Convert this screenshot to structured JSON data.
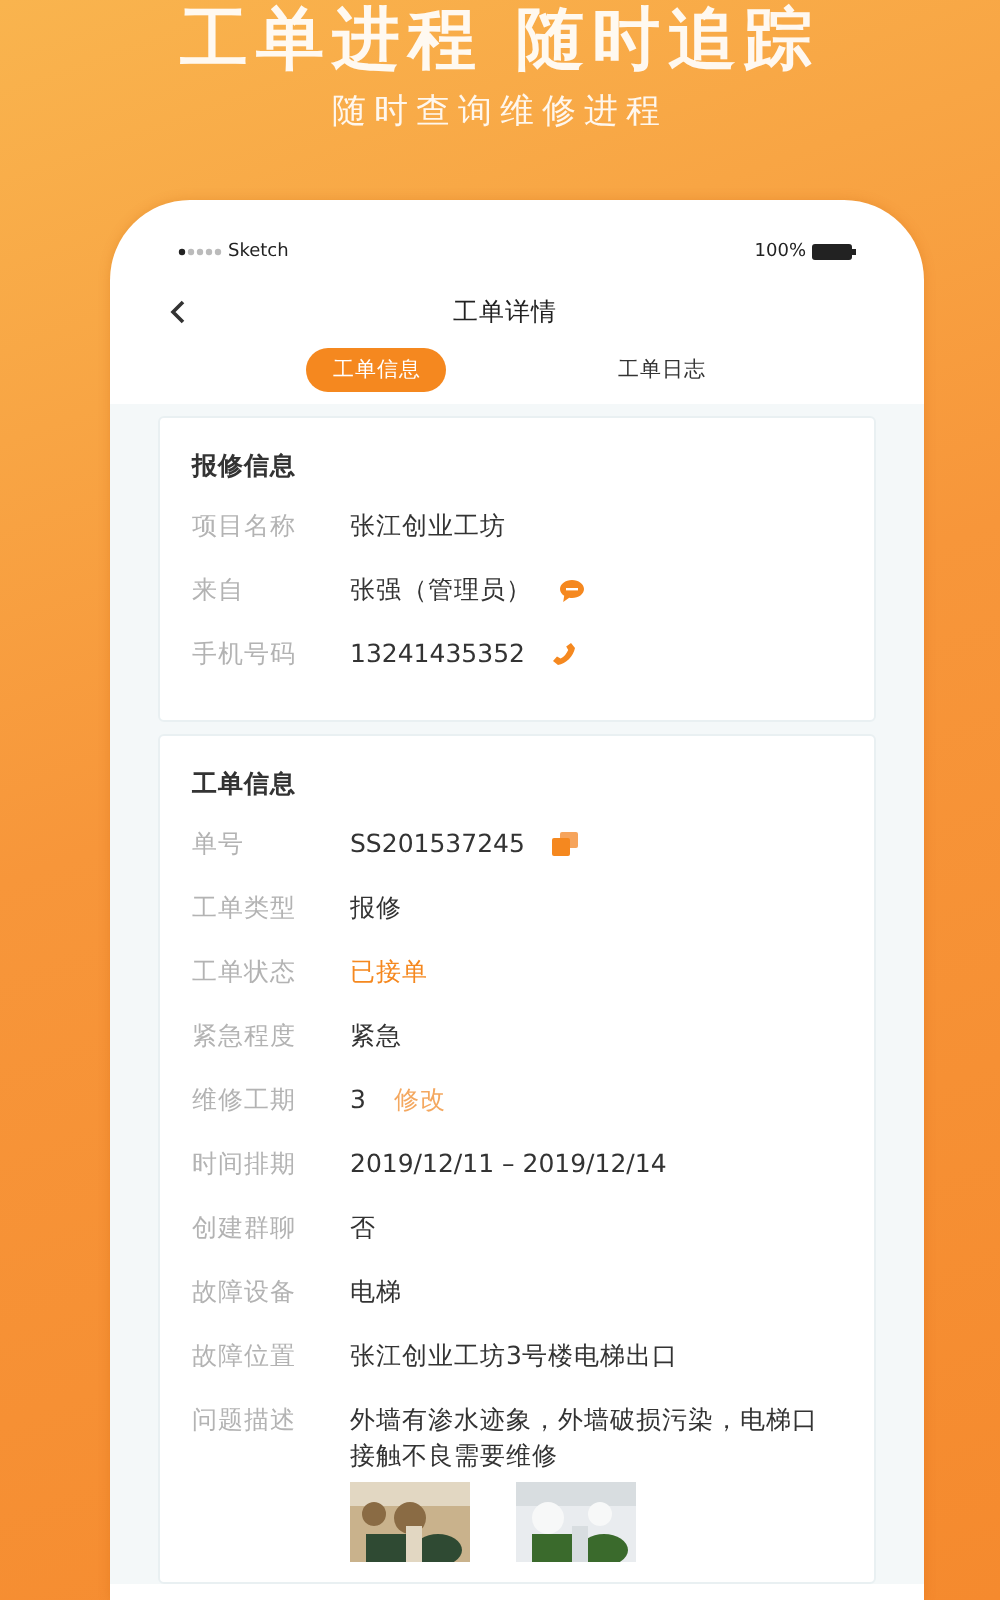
{
  "banner": {
    "title": "工单进程 随时追踪",
    "subtitle": "随时查询维修进程"
  },
  "status_bar": {
    "carrier": "Sketch",
    "battery": "100%"
  },
  "nav": {
    "title": "工单详情"
  },
  "tabs": [
    {
      "label": "工单信息",
      "selected": true
    },
    {
      "label": "工单日志",
      "selected": false
    }
  ],
  "sections": [
    {
      "title": "报修信息",
      "fields": [
        {
          "label": "项目名称",
          "value": "张江创业工坊",
          "kind": "plain"
        },
        {
          "label": "来自",
          "value": "张强（管理员）",
          "kind": "chat"
        },
        {
          "label": "手机号码",
          "value": "13241435352",
          "kind": "phone"
        }
      ]
    },
    {
      "title": "工单信息",
      "fields": [
        {
          "label": "单号",
          "value": "SS201537245",
          "kind": "copy"
        },
        {
          "label": "工单类型",
          "value": "报修",
          "kind": "plain"
        },
        {
          "label": "工单状态",
          "value": "已接单",
          "kind": "status"
        },
        {
          "label": "紧急程度",
          "value": "紧急",
          "kind": "plain"
        },
        {
          "label": "维修工期",
          "value": "3",
          "kind": "editable",
          "link": "修改"
        },
        {
          "label": "时间排期",
          "value": "2019/12/11 – 2019/12/14",
          "kind": "plain"
        },
        {
          "label": "创建群聊",
          "value": "否",
          "kind": "plain"
        },
        {
          "label": "故障设备",
          "value": "电梯",
          "kind": "plain"
        },
        {
          "label": "故障位置",
          "value": "张江创业工坊3号楼电梯出口",
          "kind": "plain"
        },
        {
          "label": "问题描述",
          "value": "外墙有渗水迹象，外墙破损污染，电梯口接触不良需要维修",
          "kind": "plain"
        }
      ]
    }
  ]
}
